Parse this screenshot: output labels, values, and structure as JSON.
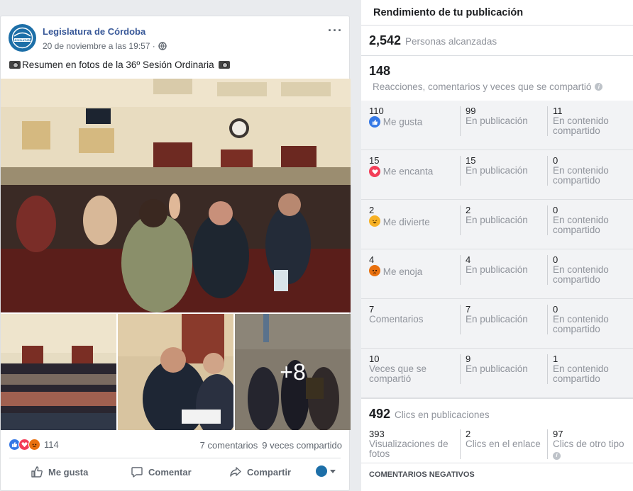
{
  "post": {
    "page_name": "Legislatura de Córdoba",
    "timestamp": "20 de noviembre a las 19:57 ·",
    "avatar_label": "LEGISLATURA",
    "text": "Resumen en fotos de la 36º Sesión Ordinaria",
    "more_photos": "+8",
    "reaction_count": "114",
    "comments": "7 comentarios",
    "shares": "9 veces compartido",
    "actions": {
      "like": "Me gusta",
      "comment": "Comentar",
      "share": "Compartir"
    }
  },
  "insights": {
    "title": "Rendimiento de tu publicación",
    "reach": {
      "value": "2,542",
      "label": "Personas alcanzadas"
    },
    "engagement": {
      "value": "148",
      "label": "Reacciones, comentarios y veces que se compartió"
    },
    "rows": [
      {
        "total": "110",
        "label": "Me gusta",
        "icon": "like-icon",
        "on_post": "99",
        "on_post_label": "En publicación",
        "on_shared": "11",
        "on_shared_label": "En contenido compartido"
      },
      {
        "total": "15",
        "label": "Me encanta",
        "icon": "love-icon",
        "on_post": "15",
        "on_post_label": "En publicación",
        "on_shared": "0",
        "on_shared_label": "En contenido compartido"
      },
      {
        "total": "2",
        "label": "Me divierte",
        "icon": "haha-icon",
        "on_post": "2",
        "on_post_label": "En publicación",
        "on_shared": "0",
        "on_shared_label": "En contenido compartido"
      },
      {
        "total": "4",
        "label": "Me enoja",
        "icon": "angry-icon",
        "on_post": "4",
        "on_post_label": "En publicación",
        "on_shared": "0",
        "on_shared_label": "En contenido compartido"
      },
      {
        "total": "7",
        "label": "Comentarios",
        "icon": "",
        "on_post": "7",
        "on_post_label": "En publicación",
        "on_shared": "0",
        "on_shared_label": "En contenido compartido"
      },
      {
        "total": "10",
        "label": "Veces que se compartió",
        "icon": "",
        "on_post": "9",
        "on_post_label": "En publicación",
        "on_shared": "1",
        "on_shared_label": "En contenido compartido"
      }
    ],
    "clicks": {
      "value": "492",
      "label": "Clics en publicaciones",
      "photo_views": "393",
      "photo_views_label": "Visualizaciones de fotos",
      "link_clicks": "2",
      "link_clicks_label": "Clics en el enlace",
      "other_clicks": "97",
      "other_clicks_label": "Clics de otro tipo"
    },
    "negative_title": "COMENTARIOS NEGATIVOS"
  },
  "colors": {
    "link": "#385898",
    "like": "#3578e5",
    "love": "#f33e58",
    "haha": "#f7b125",
    "angry": "#e9710f"
  }
}
